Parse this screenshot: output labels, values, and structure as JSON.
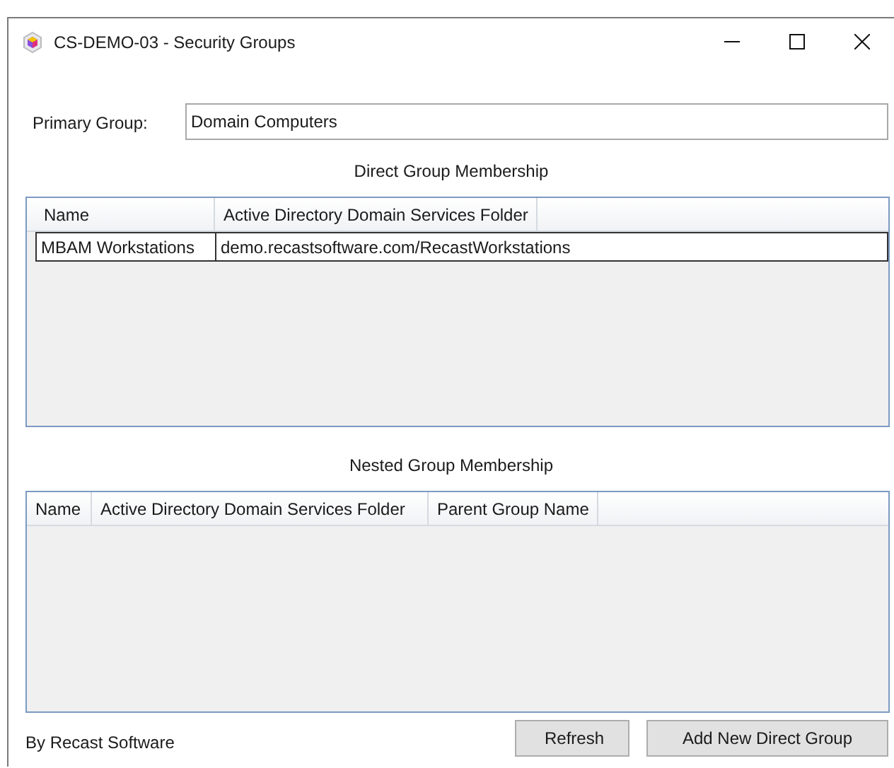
{
  "window": {
    "title": "CS-DEMO-03 - Security Groups"
  },
  "primary_group": {
    "label": "Primary Group:",
    "value": "Domain Computers"
  },
  "direct_group_membership": {
    "title": "Direct Group Membership",
    "columns": [
      "Name",
      "Active Directory Domain Services Folder"
    ],
    "rows": [
      {
        "cells": [
          "MBAM Workstations",
          "demo.recastsoftware.com/RecastWorkstations"
        ],
        "selected": false
      }
    ]
  },
  "nested_group_membership": {
    "title": "Nested Group Membership",
    "columns": [
      "Name",
      "Active Directory Domain Services Folder",
      "Parent Group Name"
    ]
  },
  "footer": {
    "credit": "By Recast Software",
    "buttons": [
      "Refresh",
      "Add New Direct Group"
    ]
  }
}
